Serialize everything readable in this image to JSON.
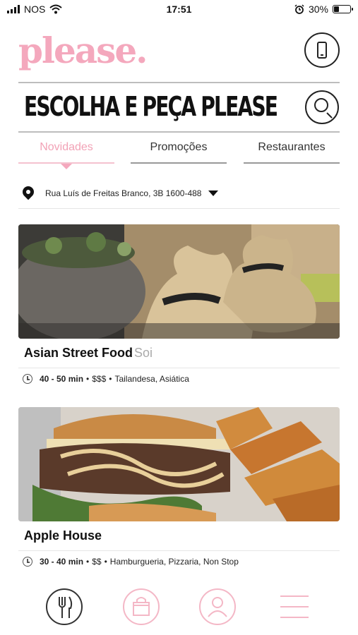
{
  "status_bar": {
    "carrier": "NOS",
    "time": "17:51",
    "battery_percent": "30%",
    "battery_level": 0.3,
    "icons": [
      "signal-icon",
      "wifi-icon",
      "alarm-icon",
      "battery-icon"
    ]
  },
  "header": {
    "logo": "please.",
    "headline": "ESCOLHA E PEÇA PLEASE",
    "phone_icon": "smartphone-icon",
    "search_icon": "search-icon"
  },
  "tabs": [
    {
      "label": "Novidades",
      "active": true
    },
    {
      "label": "Promoções",
      "active": false
    },
    {
      "label": "Restaurantes",
      "active": false
    }
  ],
  "address": {
    "text": "Rua Luís de Freitas Branco, 3B 1600-488",
    "icon": "location-pin-icon"
  },
  "restaurants": [
    {
      "name": "Asian Street Food",
      "subtitle": "Soi",
      "time": "40 - 50 min",
      "price": "$$$",
      "cuisine": "Tailandesa, Asiática",
      "image": "dumplings-photo"
    },
    {
      "name": "Apple House",
      "subtitle": "",
      "time": "30 - 40 min",
      "price": "$$",
      "cuisine": "Hamburgueria, Pizzaria, Non Stop",
      "image": "burger-fries-photo"
    }
  ],
  "meta_separator": "•",
  "bottom_nav": [
    {
      "icon": "fork-knife-icon",
      "active": true
    },
    {
      "icon": "shopping-bag-icon",
      "active": false
    },
    {
      "icon": "user-icon",
      "active": false
    },
    {
      "icon": "menu-icon",
      "active": false
    }
  ],
  "colors": {
    "brand_pink": "#f4a8bd",
    "text": "#111111",
    "muted": "#aaaaaa"
  }
}
